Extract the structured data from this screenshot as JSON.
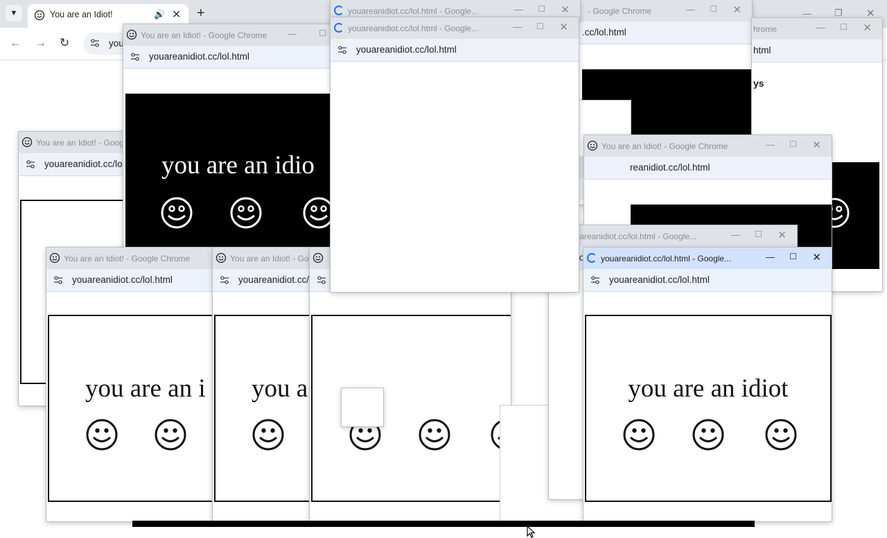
{
  "main_browser": {
    "tab_title": "You are an Idiot!",
    "address": "you",
    "new_tab": "+"
  },
  "popup_title": "You are an Idiot! - Google Chrome",
  "popup_loading_title": "youareanidiot.cc/lol.html - Google...",
  "popup_tail_title": "- Google Chrome",
  "popup_url": "youareanidiot.cc/lol.html",
  "popup_url_partial": "reanidiot.cc/lol.html",
  "popup_url_short": "yo",
  "popup_url_partial2": ".cc/lol.html",
  "popup_url_partial3": "html",
  "popup_tail_title2": "hrome",
  "fragment_text": "ys",
  "page_message": "you are an idiot",
  "page_message_clipped1": "you are an idio",
  "page_message_clipped2": "you are an i",
  "page_message_clipped3": "you a",
  "colors": {
    "titlebar": "#dfe3e8",
    "titlebar_active": "#d3e2fc",
    "addressbar": "#edf2fa",
    "loading_spinner": "#1a73e8"
  }
}
